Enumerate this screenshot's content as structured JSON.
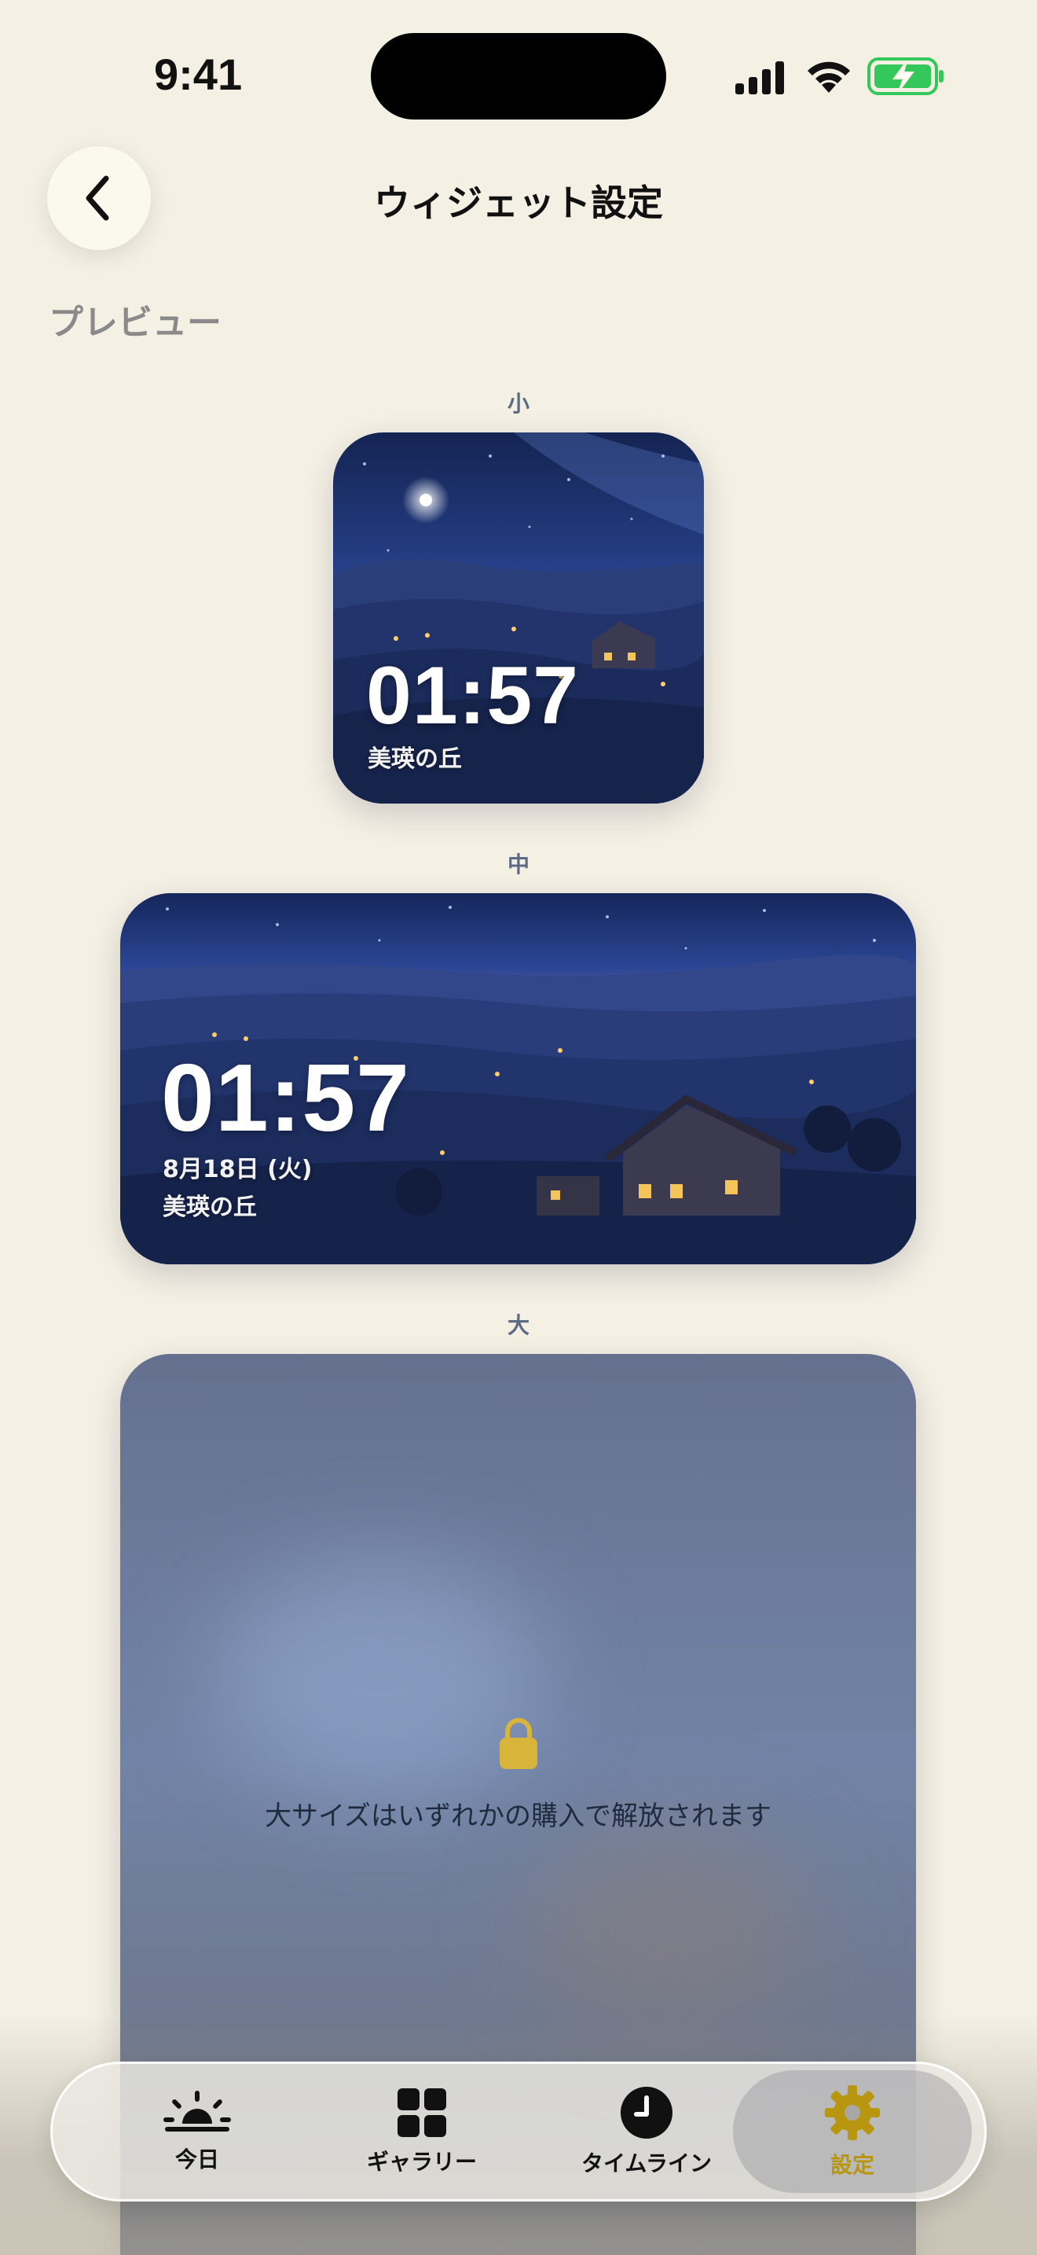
{
  "status_bar": {
    "time": "9:41"
  },
  "header": {
    "title": "ウィジェット設定"
  },
  "section": {
    "title": "プレビュー"
  },
  "widgets": {
    "small": {
      "size_label": "小",
      "time": "01:57",
      "location": "美瑛の丘"
    },
    "medium": {
      "size_label": "中",
      "time": "01:57",
      "date": "8月18日 (火)",
      "location": "美瑛の丘"
    },
    "large": {
      "size_label": "大",
      "locked_message": "大サイズはいずれかの購入で解放されます"
    }
  },
  "tab_bar": {
    "items": [
      {
        "label": "今日",
        "icon": "sunrise-icon",
        "active": false
      },
      {
        "label": "ギャラリー",
        "icon": "grid-icon",
        "active": false
      },
      {
        "label": "タイムライン",
        "icon": "clock-icon",
        "active": false
      },
      {
        "label": "設定",
        "icon": "gear-icon",
        "active": true
      }
    ]
  },
  "colors": {
    "background": "#F5F0E4",
    "accent": "#B8960F",
    "lock": "#D9B43A",
    "battery": "#34C759"
  }
}
